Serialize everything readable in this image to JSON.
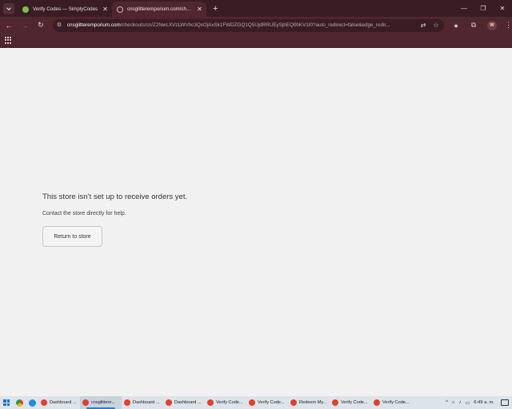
{
  "browser": {
    "tabs": [
      {
        "title": "Verify Codes — SimplyCodes",
        "active": false,
        "favicon": "check-circle-icon"
      },
      {
        "title": "cnsglitteremporium.com/checko",
        "active": true,
        "favicon": "globe-icon"
      }
    ],
    "new_tab_label": "+",
    "url_host": "cnsglitteremporium.com",
    "url_path": "/checkouts/cn/Z2NwLXVzLWVhc3QxOjAxSk1FWDZGQ1Q5UjdRRUEySjhEQ0hKV1I0?auto_redirect=false&edge_redir...",
    "profile_initial": "W",
    "accent_color": "#50262f"
  },
  "page": {
    "heading": "This store isn’t set up to receive orders yet.",
    "subtext": "Contact the store directly for help.",
    "return_button": "Return to store"
  },
  "taskbar": {
    "apps": [
      {
        "label": "Dashboard ...",
        "color": "#e0412f",
        "active": false
      },
      {
        "label": "cnsglittere...",
        "color": "#e0412f",
        "active": true
      },
      {
        "label": "Dashboard ...",
        "color": "#e0412f",
        "active": false
      },
      {
        "label": "Dashboard ...",
        "color": "#e0412f",
        "active": false
      },
      {
        "label": "Verify Code...",
        "color": "#e0412f",
        "active": false
      },
      {
        "label": "Verify Code...",
        "color": "#e0412f",
        "active": false
      },
      {
        "label": "Redeem My...",
        "color": "#e0412f",
        "active": false
      },
      {
        "label": "Verify Code...",
        "color": "#e0412f",
        "active": false
      },
      {
        "label": "Verify Code...",
        "color": "#e0412f",
        "active": false
      }
    ],
    "time": "6:49 a. m."
  }
}
